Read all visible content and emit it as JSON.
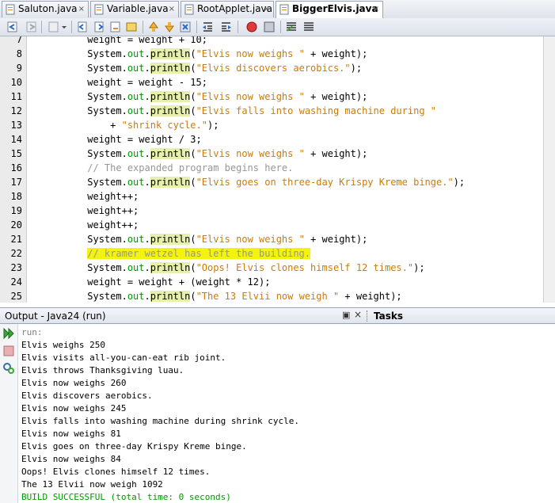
{
  "tabs": [
    {
      "label": "Saluton.java",
      "close": "×"
    },
    {
      "label": "Variable.java",
      "close": "×"
    },
    {
      "label": "RootApplet.java",
      "close": "×"
    },
    {
      "label": "BiggerElvis.java",
      "close": "×",
      "active": true
    }
  ],
  "toolbar": {
    "icons": [
      "back-icon",
      "forward-icon",
      "find-prev-icon",
      "find-next-icon",
      "toggle-highlight-icon",
      "prev-bookmark-icon",
      "next-bookmark-icon",
      "toggle-bookmark-icon",
      "shift-left-icon",
      "shift-right-icon",
      "start-macro-icon",
      "stop-macro-icon",
      "comment-icon",
      "uncomment-icon"
    ]
  },
  "editor": {
    "lines": [
      {
        "n": "7",
        "t": "weight = weight + 10;"
      },
      {
        "n": "8",
        "p": "System.",
        "f": "out",
        "d": ".",
        "m": "println",
        "o": "(",
        "s": "\"Elvis now weighs \"",
        "r": " + weight);"
      },
      {
        "n": "9",
        "p": "System.",
        "f": "out",
        "d": ".",
        "m": "println",
        "o": "(",
        "s": "\"Elvis discovers aerobics.\"",
        "r": ");"
      },
      {
        "n": "10",
        "t": "weight = weight - 15;"
      },
      {
        "n": "11",
        "p": "System.",
        "f": "out",
        "d": ".",
        "m": "println",
        "o": "(",
        "s": "\"Elvis now weighs \"",
        "r": " + weight);"
      },
      {
        "n": "12",
        "p": "System.",
        "f": "out",
        "d": ".",
        "m": "println",
        "o": "(",
        "s": "\"Elvis falls into washing machine during \"",
        "r": ""
      },
      {
        "n": "13",
        "t2": "    + ",
        "s2": "\"shrink cycle.\"",
        "r2": ");"
      },
      {
        "n": "14",
        "t": "weight = weight / 3;"
      },
      {
        "n": "15",
        "p": "System.",
        "f": "out",
        "d": ".",
        "m": "println",
        "o": "(",
        "s": "\"Elvis now weighs \"",
        "r": " + weight);"
      },
      {
        "n": "16",
        "c": "// The expanded program begins here."
      },
      {
        "n": "17",
        "p": "System.",
        "f": "out",
        "d": ".",
        "m": "println",
        "o": "(",
        "s": "\"Elvis goes on three-day Krispy Kreme binge.\"",
        "r": ");"
      },
      {
        "n": "18",
        "t": "weight++;"
      },
      {
        "n": "19",
        "t": "weight++;"
      },
      {
        "n": "20",
        "t": "weight++;"
      },
      {
        "n": "21",
        "p": "System.",
        "f": "out",
        "d": ".",
        "m": "println",
        "o": "(",
        "s": "\"Elvis now weighs \"",
        "r": " + weight);"
      },
      {
        "n": "22",
        "h": "// kramer wetzel has left the building."
      },
      {
        "n": "23",
        "p": "System.",
        "f": "out",
        "d": ".",
        "m": "println",
        "o": "(",
        "s": "\"Oops! Elvis clones himself 12 times.\"",
        "r": ");"
      },
      {
        "n": "24",
        "t": "weight = weight + (weight * 12);"
      },
      {
        "n": "25",
        "p": "System.",
        "f": "out",
        "d": ".",
        "m": "println",
        "o": "(",
        "s": "\"The 13 Elvii now weigh \"",
        "r": " + weight);"
      }
    ]
  },
  "output": {
    "title": "Output - Java24 (run)",
    "pin": "▣",
    "close": "×",
    "tasks": "Tasks",
    "lines": [
      "run:",
      "Elvis weighs 250",
      "Elvis visits all-you-can-eat rib joint.",
      "Elvis throws Thanksgiving luau.",
      "Elvis now weighs 260",
      "Elvis discovers aerobics.",
      "Elvis now weighs 245",
      "Elvis falls into washing machine during shrink cycle.",
      "Elvis now weighs 81",
      "Elvis goes on three-day Krispy Kreme binge.",
      "Elvis now weighs 84",
      "Oops! Elvis clones himself 12 times.",
      "The 13 Elvii now weigh 1092",
      "BUILD SUCCESSFUL (total time: 0 seconds)"
    ]
  },
  "colors": {
    "string": "#ce7b00",
    "field": "#009900",
    "method_bg": "#e6efad",
    "comment": "#969696",
    "highlight": "#f3f30f"
  }
}
